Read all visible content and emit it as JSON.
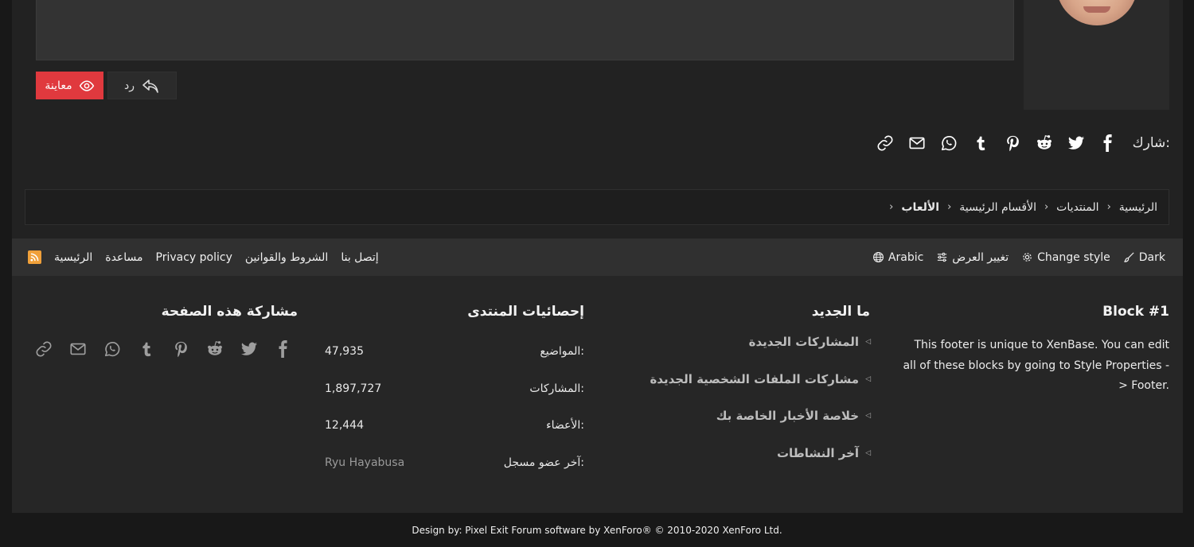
{
  "editor": {
    "preview_label": "معاينة",
    "reply_label": "رد"
  },
  "share": {
    "label": "شارك:",
    "icons": [
      "facebook-icon",
      "twitter-icon",
      "reddit-icon",
      "pinterest-icon",
      "tumblr-icon",
      "whatsapp-icon",
      "email-icon",
      "link-icon"
    ]
  },
  "breadcrumb": {
    "items": [
      "الرئيسية",
      "المنتديات",
      "الأقسام الرئيسية",
      "الألعاب"
    ]
  },
  "footer_nav": {
    "right": {
      "dark_label": "Dark",
      "change_style_label": "Change style",
      "change_view_label": "تغيير العرض",
      "language_label": "Arabic"
    },
    "left": {
      "contact_label": "إتصل بنا",
      "terms_label": "الشروط والقوانين",
      "privacy_label": "Privacy policy",
      "help_label": "مساعدة",
      "home_label": "الرئيسية"
    }
  },
  "footer_blocks": {
    "block1": {
      "title": "Block #1",
      "text": "This footer is unique to XenBase. You can edit all of these blocks by going to Style Properties -> Footer."
    },
    "whats_new": {
      "title": "ما الجديد",
      "items": [
        "المشاركات الجديدة",
        "مشاركات الملفات الشخصية الجديدة",
        "خلاصة الأخبار الخاصة بك",
        "آخر النشاطات"
      ]
    },
    "stats": {
      "title": "إحصائيات المنتدى",
      "threads_label": "المواضيع:",
      "threads_value": "47,935",
      "posts_label": "المشاركات:",
      "posts_value": "1,897,727",
      "members_label": "الأعضاء:",
      "members_value": "12,444",
      "latest_member_label": "آخر عضو مسجل:",
      "latest_member_value": "Ryu Hayabusa"
    },
    "share_page": {
      "title": "مشاركة هذه الصفحة"
    }
  },
  "copyright": "Design by: Pixel Exit Forum software by XenForo® © 2010-2020 XenForo Ltd.",
  "colors": {
    "accent": "#e0393e",
    "background": "#181818",
    "panel": "#222222",
    "rss": "#f0a03a"
  }
}
